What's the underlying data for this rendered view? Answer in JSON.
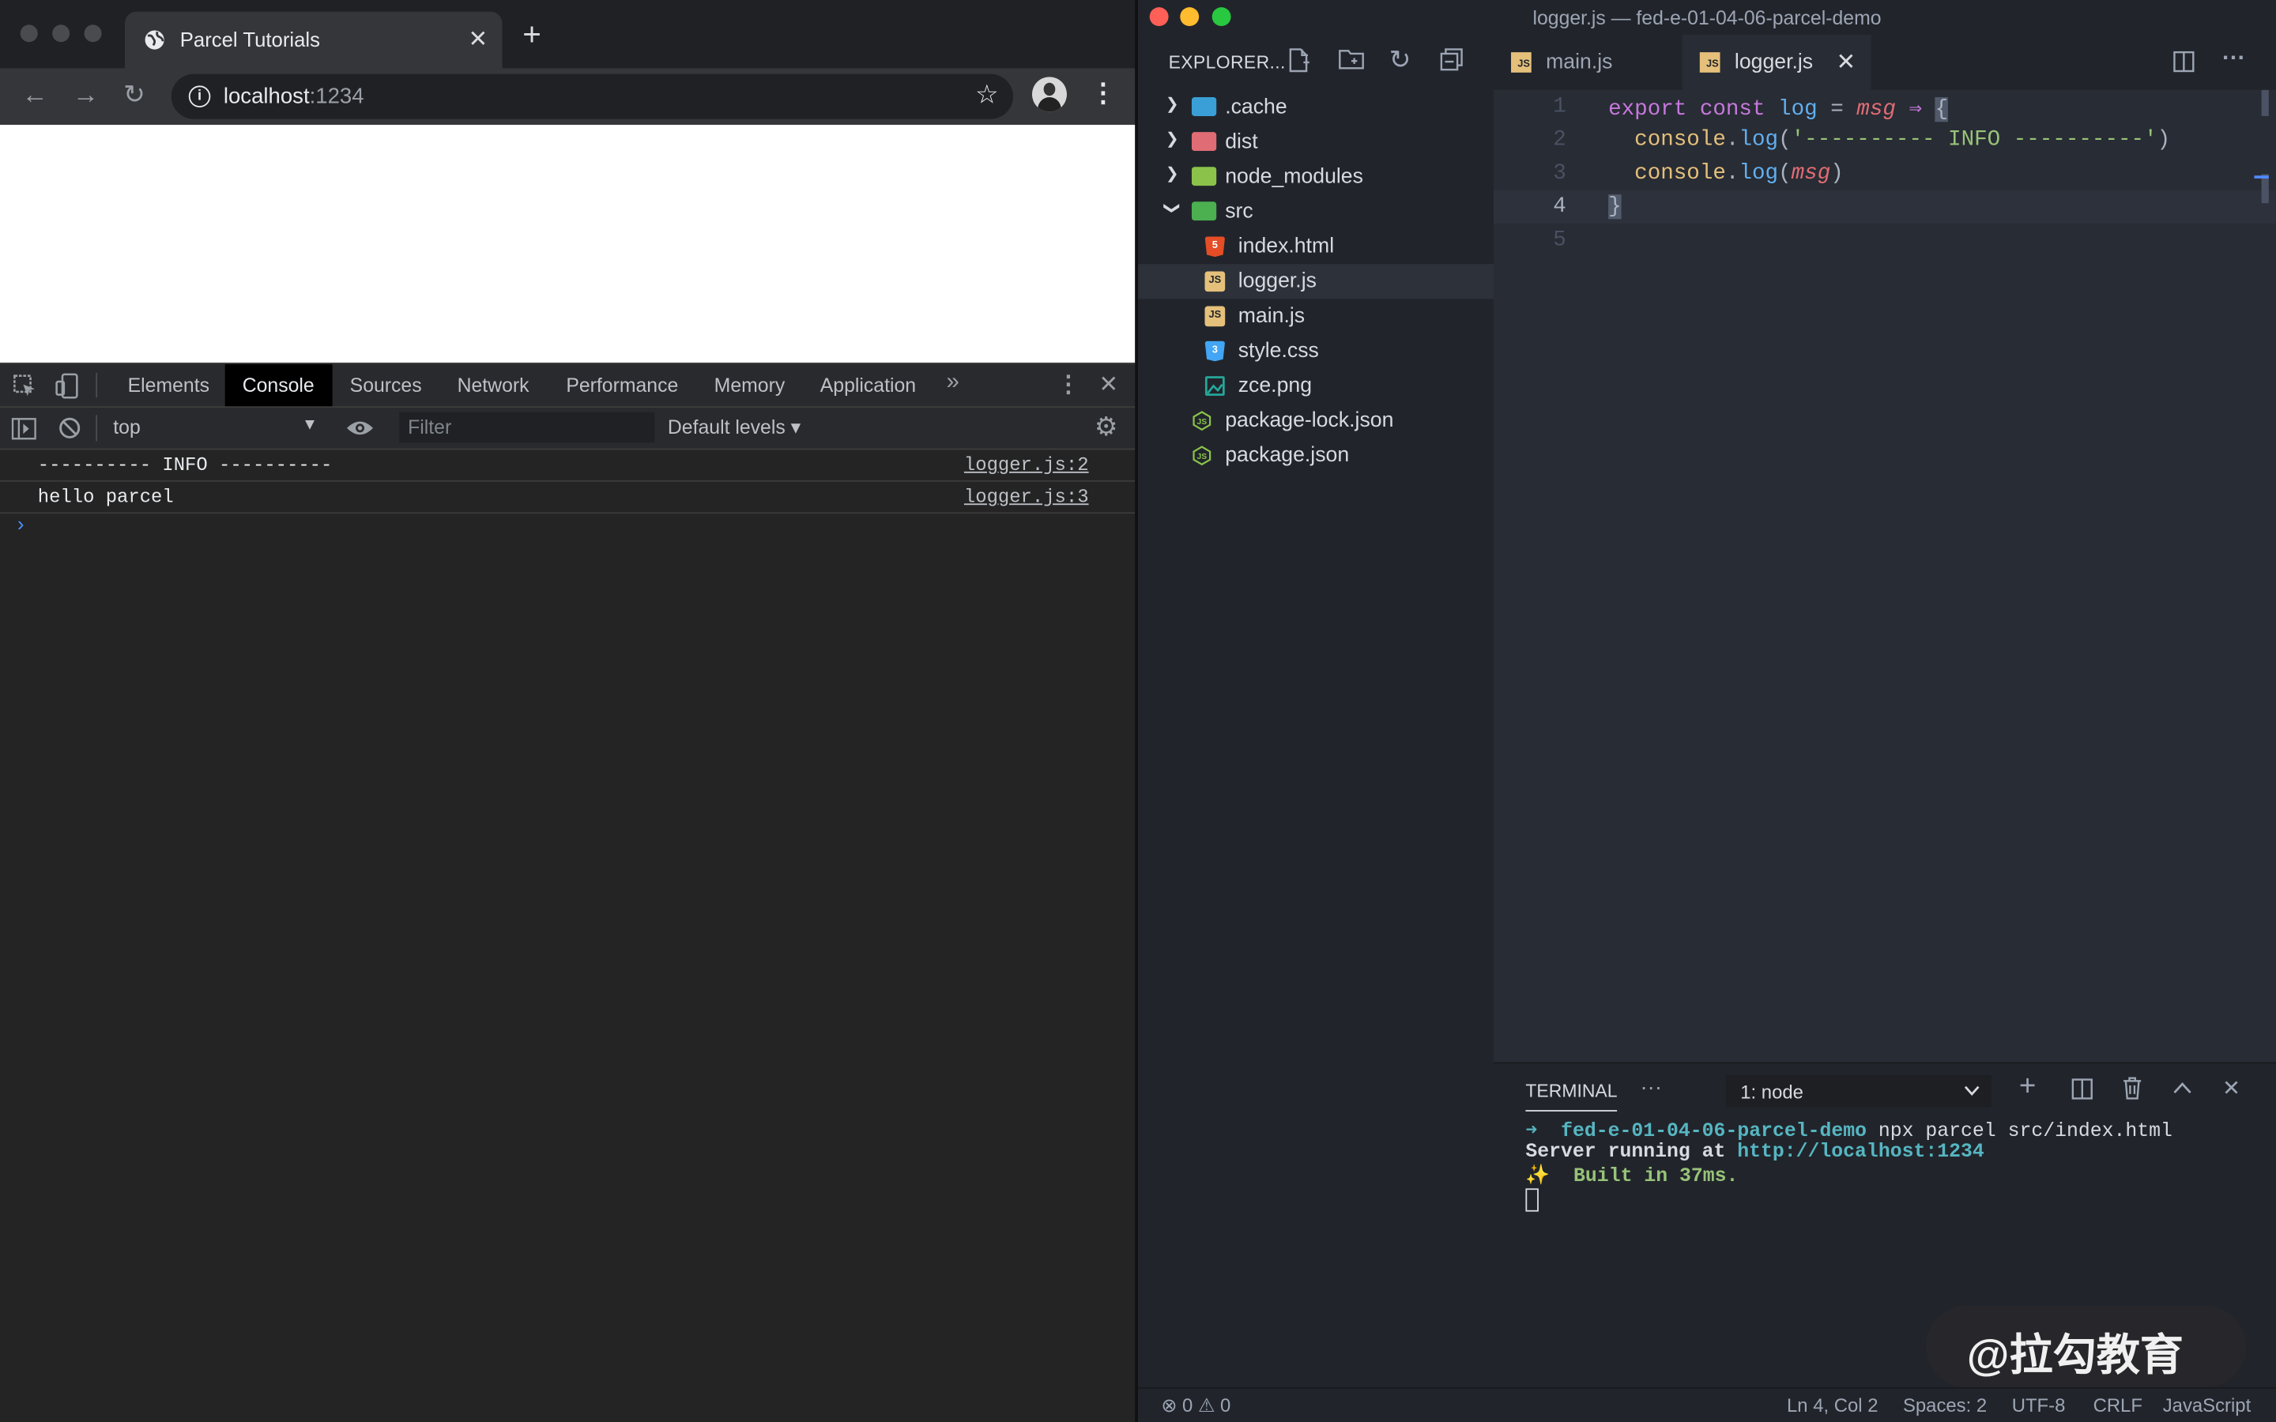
{
  "browser": {
    "tab_title": "Parcel Tutorials",
    "url_host": "localhost",
    "url_port": ":1234"
  },
  "devtools": {
    "tabs": [
      "Elements",
      "Console",
      "Sources",
      "Network",
      "Performance",
      "Memory",
      "Application"
    ],
    "active_tab": "Console",
    "context": "top",
    "filter_placeholder": "Filter",
    "levels": "Default levels",
    "logs": [
      {
        "message": "---------- INFO ----------",
        "source": "logger.js:2"
      },
      {
        "message": "hello parcel",
        "source": "logger.js:3"
      }
    ]
  },
  "vscode": {
    "window_title": "logger.js — fed-e-01-04-06-parcel-demo",
    "explorer_label": "EXPLORER...",
    "tree": [
      {
        "name": ".cache",
        "type": "folder"
      },
      {
        "name": "dist",
        "type": "folder"
      },
      {
        "name": "node_modules",
        "type": "folder"
      },
      {
        "name": "src",
        "type": "folder-open"
      },
      {
        "name": "index.html",
        "type": "html"
      },
      {
        "name": "logger.js",
        "type": "js"
      },
      {
        "name": "main.js",
        "type": "js"
      },
      {
        "name": "style.css",
        "type": "css"
      },
      {
        "name": "zce.png",
        "type": "png"
      },
      {
        "name": "package-lock.json",
        "type": "json"
      },
      {
        "name": "package.json",
        "type": "json"
      }
    ],
    "editor_tabs": [
      "main.js",
      "logger.js"
    ],
    "active_editor_tab": "logger.js",
    "line_numbers": [
      "1",
      "2",
      "3",
      "4",
      "5"
    ],
    "code": {
      "l1_kw": "export const ",
      "l1_fn": "log",
      "l1_eq": " = ",
      "l1_prm": "msg",
      "l1_arrow": " ⇒ ",
      "l1_brace": "{",
      "l2_obj": "console",
      "l2_dot": ".",
      "l2_fn": "log",
      "l2_open": "(",
      "l2_str": "'---------- INFO ----------'",
      "l2_close": ")",
      "l3_obj": "console",
      "l3_dot": ".",
      "l3_fn": "log",
      "l3_open": "(",
      "l3_prm": "msg",
      "l3_close": ")",
      "l4_brace": "}"
    },
    "terminal": {
      "tab_label": "TERMINAL",
      "more": "···",
      "dropdown": "1: node",
      "prompt_arrow": "➜",
      "cwd": "fed-e-01-04-06-parcel-demo",
      "command": " npx parcel src/index.html",
      "server_text": "Server running at ",
      "server_url": "http://localhost:1234",
      "sparkle": "✨",
      "built": "  Built in 37ms."
    },
    "status": {
      "problems": "⊗ 0 ⚠ 0",
      "position": "Ln 4, Col 2",
      "spaces": "Spaces: 2",
      "encoding": "UTF-8",
      "eol": "CRLF",
      "language": "JavaScript"
    }
  },
  "watermark": "@拉勾教育"
}
